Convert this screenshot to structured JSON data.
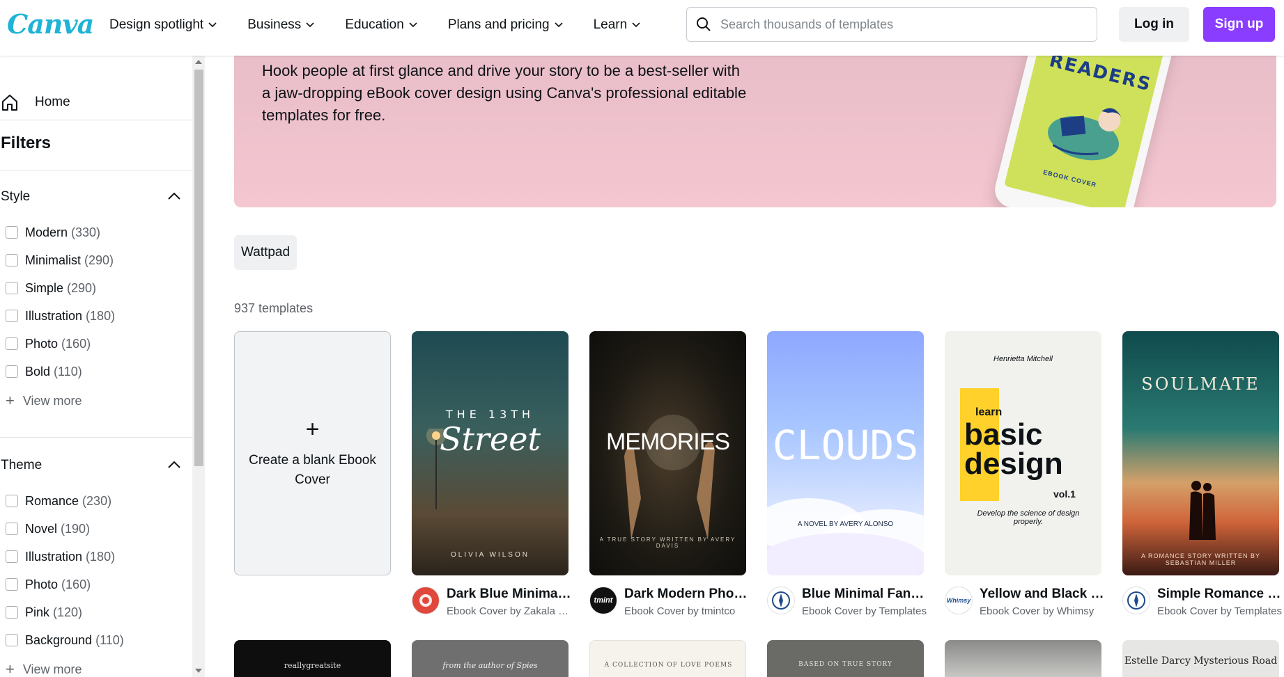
{
  "header": {
    "logo": "Canva",
    "nav": [
      {
        "label": "Design spotlight"
      },
      {
        "label": "Business"
      },
      {
        "label": "Education"
      },
      {
        "label": "Plans and pricing"
      },
      {
        "label": "Learn"
      }
    ],
    "search_placeholder": "Search thousands of templates",
    "login_label": "Log in",
    "signup_label": "Sign up",
    "accent_color": "#8b3dff"
  },
  "sidebar": {
    "home_label": "Home",
    "filters_title": "Filters",
    "style": {
      "title": "Style",
      "items": [
        {
          "label": "Modern",
          "count": "(330)"
        },
        {
          "label": "Minimalist",
          "count": "(290)"
        },
        {
          "label": "Simple",
          "count": "(290)"
        },
        {
          "label": "Illustration",
          "count": "(180)"
        },
        {
          "label": "Photo",
          "count": "(160)"
        },
        {
          "label": "Bold",
          "count": "(110)"
        }
      ],
      "view_more": "View more"
    },
    "theme": {
      "title": "Theme",
      "items": [
        {
          "label": "Romance",
          "count": "(230)"
        },
        {
          "label": "Novel",
          "count": "(190)"
        },
        {
          "label": "Illustration",
          "count": "(180)"
        },
        {
          "label": "Photo",
          "count": "(160)"
        },
        {
          "label": "Pink",
          "count": "(120)"
        },
        {
          "label": "Background",
          "count": "(110)"
        }
      ],
      "view_more": "View more"
    }
  },
  "hero": {
    "description": "Hook people at first glance and drive your story to be a best-seller with a jaw-dropping eBook cover design using Canva's professional editable templates for free.",
    "phone_title": "READERS",
    "phone_sub": "EBOOK COVER"
  },
  "chip": "Wattpad",
  "template_count": "937 templates",
  "blank_card_label": "Create a blank Ebook Cover",
  "templates": [
    {
      "title": "Dark Blue Minimalist Photo Thriller Ebook Cover",
      "author": "Ebook Cover by Zakala Studio",
      "cover_line1": "THE 13TH",
      "cover_line2": "Street",
      "cover_line3": "OLIVIA WILSON"
    },
    {
      "title": "Dark Modern Photo Ebook Cover",
      "author": "Ebook Cover by tmintco",
      "avatar_text": "tmint",
      "cover_line1": "MEMORIES",
      "cover_line2": "A TRUE STORY WRITTEN BY AVERY DAVIS"
    },
    {
      "title": "Blue Minimal Fantasy Ebook Cover",
      "author": "Ebook Cover by Templates",
      "cover_line1": "CLOUDS",
      "cover_line2": "A NOVEL BY AVERY ALONSO"
    },
    {
      "title": "Yellow and Black Simple Ebook Cover",
      "author": "Ebook Cover by Whimsy",
      "avatar_text": "Whimsy",
      "cover_line0": "Henrietta Mitchell",
      "cover_line1": "learn",
      "cover_line2": "basic design",
      "cover_line3": "vol.1",
      "cover_line4": "Develop the science of design properly."
    },
    {
      "title": "Simple Romance Story Ebook Cover",
      "author": "Ebook Cover by Templates",
      "cover_line1": "SOULMATE",
      "cover_line2": "A ROMANCE STORY WRITTEN BY SEBASTIAN MILLER"
    }
  ],
  "row2": [
    {
      "text": "reallygreatsite"
    },
    {
      "text": "from the author of Spies"
    },
    {
      "text": "A COLLECTION OF LOVE POEMS"
    },
    {
      "text": "BASED ON TRUE STORY"
    },
    {
      "text": ""
    },
    {
      "text": "Estelle Darcy Mysterious Road"
    }
  ]
}
